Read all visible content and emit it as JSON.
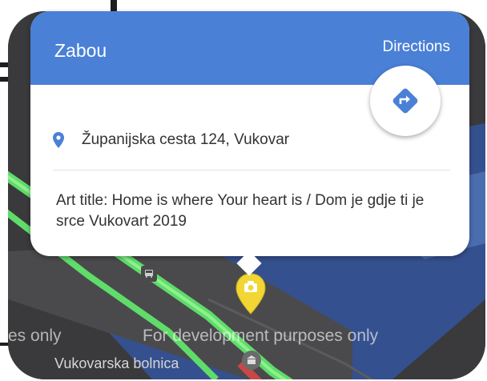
{
  "popup": {
    "place_name": "Zabou",
    "directions_label": "Directions",
    "address": "Županijska cesta 124, Vukovar",
    "description": "Art title: Home is where Your heart is / Dom je gdje ti je srce Vukovart 2019"
  },
  "map": {
    "watermark_left": "es only",
    "watermark_right": "For development purposes only",
    "hospital_label": "Vukovarska bolnica"
  },
  "icons": {
    "address": "map-pin-icon",
    "directions": "directions-diamond-icon",
    "marker": "camera-marker-icon",
    "hospital": "hospital-icon",
    "transit": "bus-icon"
  },
  "colors": {
    "header": "#4a80d6",
    "river": "#35508e",
    "road_highlight": "#5fdc6a",
    "marker": "#f2d633"
  }
}
